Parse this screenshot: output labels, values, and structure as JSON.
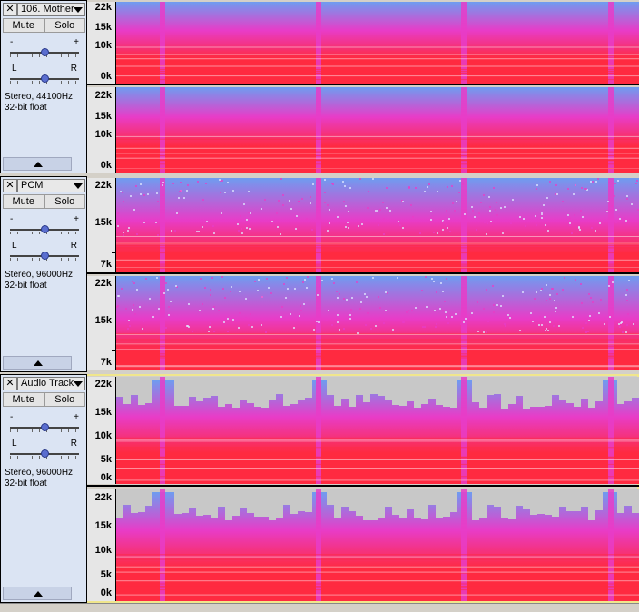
{
  "tracks": [
    {
      "name": "106. Mother",
      "mute": "Mute",
      "solo": "Solo",
      "gain": {
        "minus": "-",
        "plus": "+"
      },
      "pan": {
        "left": "L",
        "right": "R"
      },
      "info_line1": "Stereo, 44100Hz",
      "info_line2": "32-bit float",
      "ruler_labels": [
        "22k",
        "15k",
        "10k",
        "0k"
      ],
      "style": "full"
    },
    {
      "name": "PCM",
      "mute": "Mute",
      "solo": "Solo",
      "gain": {
        "minus": "-",
        "plus": "+"
      },
      "pan": {
        "left": "L",
        "right": "R"
      },
      "info_line1": "Stereo, 96000Hz",
      "info_line2": "32-bit float",
      "ruler_labels": [
        "22k",
        "15k",
        "7k"
      ],
      "style": "grain"
    },
    {
      "name": "Audio Track",
      "mute": "Mute",
      "solo": "Solo",
      "gain": {
        "minus": "-",
        "plus": "+"
      },
      "pan": {
        "left": "L",
        "right": "R"
      },
      "info_line1": "Stereo, 96000Hz",
      "info_line2": "32-bit float",
      "ruler_labels": [
        "22k",
        "15k",
        "10k",
        "5k",
        "0k"
      ],
      "style": "capped"
    }
  ],
  "colors": {
    "spectrogram_low": "#ff2a40",
    "spectrogram_mid": "#e83cc8",
    "spectrogram_high": "#6f9cf0",
    "background": "#d4d0c8",
    "panel": "#dbe4f3"
  },
  "icons": {
    "close": "close-icon",
    "menu": "dropdown-arrow-icon",
    "collapse": "collapse-arrow-icon"
  }
}
